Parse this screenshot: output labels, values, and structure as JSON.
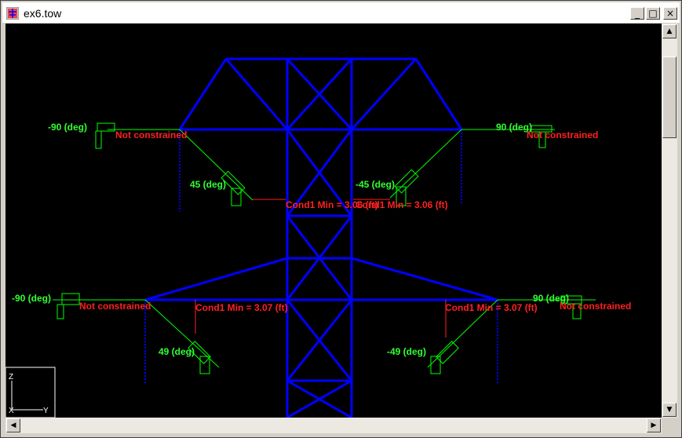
{
  "window": {
    "title": "ex6.tow",
    "minimize_symbol": "_",
    "maximize_symbol": "□",
    "close_symbol": "×"
  },
  "colors": {
    "tower": "#0000ff",
    "insulator": "#00ff00",
    "angle_label": "#33ff33",
    "clearance_label": "#ff2020",
    "background": "#000000"
  },
  "insulators": [
    {
      "id": "upper-left-outer",
      "angle_label": "-90 (deg)",
      "status": "Not constrained"
    },
    {
      "id": "upper-right-outer",
      "angle_label": "90 (deg)",
      "status": "Not constrained"
    },
    {
      "id": "upper-left-inner",
      "angle_label": "45 (deg)",
      "status": "Cond1 Min = 3.06 (ft)"
    },
    {
      "id": "upper-right-inner",
      "angle_label": "-45 (deg)",
      "status": "Cond1 Min = 3.06 (ft)"
    },
    {
      "id": "lower-left-outer",
      "angle_label": "-90 (deg)",
      "status": "Not constrained"
    },
    {
      "id": "lower-right-outer",
      "angle_label": "90 (deg)",
      "status": "Not constrained"
    },
    {
      "id": "lower-left-inner",
      "angle_label": "49 (deg)",
      "status": "Cond1 Min = 3.07 (ft)"
    },
    {
      "id": "lower-right-inner",
      "angle_label": "-49 (deg)",
      "status": "Cond1 Min = 3.07 (ft)"
    }
  ],
  "axes": {
    "z": "Z",
    "x": "X",
    "y": "Y"
  },
  "scrollbars": {
    "up": "▲",
    "down": "▼",
    "left": "◀",
    "right": "▶"
  }
}
